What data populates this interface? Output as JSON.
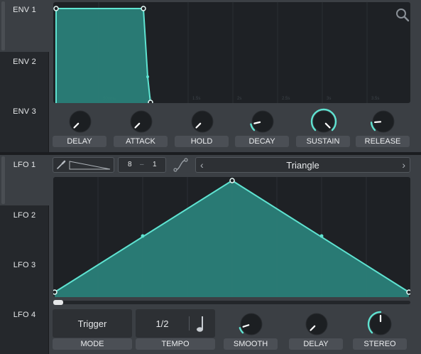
{
  "env_tabs": [
    "ENV 1",
    "ENV 2",
    "ENV 3"
  ],
  "lfo_tabs": [
    "LFO 1",
    "LFO 2",
    "LFO 3",
    "LFO 4"
  ],
  "env_active": 0,
  "lfo_active": 0,
  "env": {
    "time_ticks": [
      "500ms",
      "1s",
      "1.5s",
      "2s",
      "2.5s",
      "3s",
      "3.5s"
    ],
    "knobs": [
      {
        "label": "DELAY",
        "value": 0.0
      },
      {
        "label": "ATTACK",
        "value": 0.0
      },
      {
        "label": "HOLD",
        "value": 0.0
      },
      {
        "label": "DECAY",
        "value": 0.12
      },
      {
        "label": "SUSTAIN",
        "value": 1.0
      },
      {
        "label": "RELEASE",
        "value": 0.15
      }
    ]
  },
  "lfo": {
    "grid_x": "8",
    "grid_y": "1",
    "shape_name": "Triangle",
    "mode_value": "Trigger",
    "mode_label": "MODE",
    "tempo_value": "1/2",
    "tempo_label": "TEMPO",
    "knobs": [
      {
        "label": "SMOOTH",
        "value": 0.1
      },
      {
        "label": "DELAY",
        "value": 0.0
      },
      {
        "label": "STEREO",
        "value": 0.5
      }
    ]
  },
  "colors": {
    "accent": "#5fe3d1",
    "fill": "#2a7f78",
    "panel": "#3b3f44",
    "graph_bg": "#1e2125"
  }
}
